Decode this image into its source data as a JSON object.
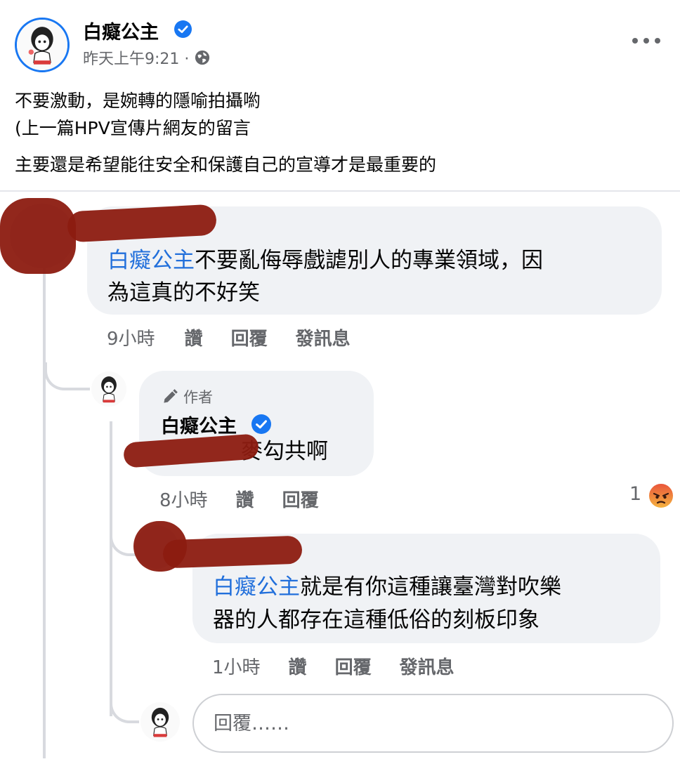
{
  "post": {
    "page_name": "白癡公主",
    "timestamp": "昨天上午9:21 ·",
    "privacy_icon": "globe-icon",
    "more_icon": "more-horizontal-icon",
    "lines": [
      "不要激動，是婉轉的隱喻拍攝喲",
      "(上一篇HPV宣傳片網友的留言",
      "主要還是希望能往安全和保護自己的宣導才是最重要的"
    ]
  },
  "comments": [
    {
      "mention": "白癡公主",
      "text_line1": "不要亂侮辱戲謔別人的專業領域，因",
      "text_line2": "為這真的不好笑",
      "time": "9小時",
      "like": "讚",
      "reply": "回覆",
      "message": "發訊息"
    },
    {
      "author_tag": "作者",
      "name": "白癡公主",
      "text": "麥勾共啊",
      "time": "8小時",
      "like": "讚",
      "reply": "回覆",
      "reaction_count": "1",
      "reaction_icon": "angry-emoji-icon"
    },
    {
      "mention": "白癡公主",
      "text_line1": "就是有你這種讓臺灣對吹樂",
      "text_line2": "器的人都存在這種低俗的刻板印象",
      "time": "1小時",
      "like": "讚",
      "reply": "回覆",
      "message": "發訊息"
    }
  ],
  "reply_box": {
    "placeholder": "回覆……"
  },
  "colors": {
    "mention": "#216fdb",
    "verified": "#1877f2",
    "bubble": "#f0f2f5",
    "secondary_text": "#65676b",
    "redaction": "#8c1b10"
  }
}
